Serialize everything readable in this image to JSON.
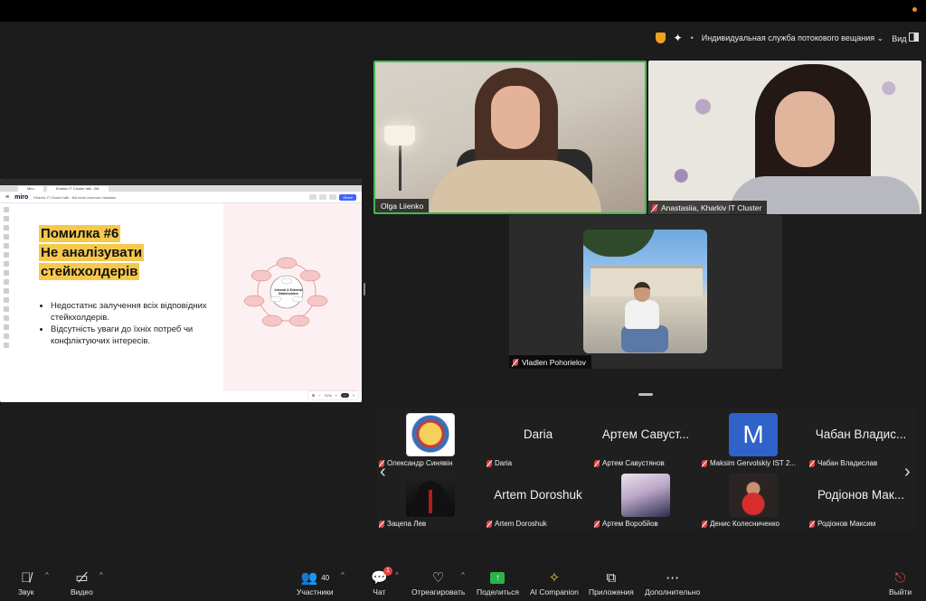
{
  "streaming": {
    "label": "Индивидуальная служба потокового вещания",
    "view_label": "Вид"
  },
  "shared_screen": {
    "browser_tabs": [
      "Miro",
      "Kharkiv IT Cluster talk - BA"
    ],
    "app_name": "miro",
    "breadcrumb": "Kharkiv IT Cluster talk - BA most common mistakes",
    "share_button": "Share",
    "slide": {
      "title_line1": "Помилка #6",
      "title_line2": "Не аналізувати",
      "title_line3": "стейкхолдерів",
      "bullets": [
        "Недостатнє залучення всіх відповідних стейкхолдерів.",
        "Відсутність уваги до їхніх потреб чи конфліктуючих інтересів."
      ]
    },
    "diagram_center": "Internal & External Stakeholders",
    "zoom": "71%"
  },
  "participants": {
    "olga": "Olga Liienko",
    "anastasiia": "Anastasiia, Kharkiv IT Cluster",
    "vladlen": "Vladlen Pohorielov"
  },
  "gallery": [
    {
      "big": "",
      "label": "Олександр Синявін",
      "img": "logo"
    },
    {
      "big": "Daria",
      "label": "Daria",
      "img": ""
    },
    {
      "big": "Артем Савуст...",
      "label": "Артем Савустянов",
      "img": ""
    },
    {
      "big": "",
      "label": "Maksim Gervolskiy IST 2...",
      "img": "m",
      "letter": "M"
    },
    {
      "big": "Чабан Владис...",
      "label": "Чабан Владислав",
      "img": ""
    },
    {
      "big": "",
      "label": "Зацепа Лев",
      "img": "suit"
    },
    {
      "big": "Artem Doroshuk",
      "label": "Artem Doroshuk",
      "img": ""
    },
    {
      "big": "",
      "label": "Артем Воробйов",
      "img": "anime"
    },
    {
      "big": "",
      "label": "Денис Колесниченко",
      "img": "red"
    },
    {
      "big": "Родіонов Мак...",
      "label": "Родіонов Максим",
      "img": ""
    }
  ],
  "toolbar": {
    "audio": "Звук",
    "video": "Видео",
    "participants": "Участники",
    "participants_count": "40",
    "chat": "Чат",
    "chat_badge": "1",
    "react": "Отреагировать",
    "share": "Поделиться",
    "ai": "AI Companion",
    "apps": "Приложения",
    "more": "Дополнительно",
    "leave": "Выйти"
  },
  "colors": {
    "active_speaker": "#3fb950",
    "highlight": "#f6c94c",
    "muted": "#e04545",
    "share_green": "#2db24a"
  }
}
